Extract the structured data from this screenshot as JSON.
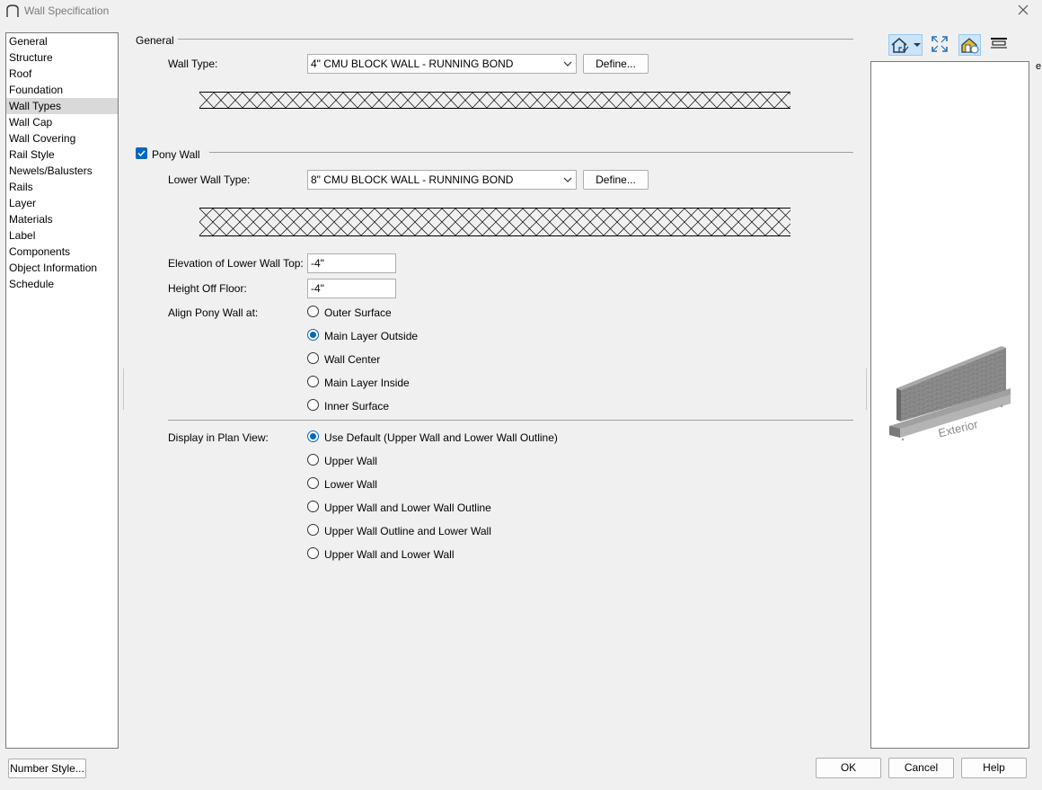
{
  "window": {
    "title": "Wall Specification"
  },
  "sidebar": {
    "items": [
      {
        "label": "General"
      },
      {
        "label": "Structure"
      },
      {
        "label": "Roof"
      },
      {
        "label": "Foundation"
      },
      {
        "label": "Wall Types",
        "selected": true
      },
      {
        "label": "Wall Cap"
      },
      {
        "label": "Wall Covering"
      },
      {
        "label": "Rail Style"
      },
      {
        "label": "Newels/Balusters"
      },
      {
        "label": "Rails"
      },
      {
        "label": "Layer"
      },
      {
        "label": "Materials"
      },
      {
        "label": "Label"
      },
      {
        "label": "Components"
      },
      {
        "label": "Object Information"
      },
      {
        "label": "Schedule"
      }
    ]
  },
  "general": {
    "section_label": "General",
    "wall_type_label": "Wall Type:",
    "wall_type_value": "4\" CMU BLOCK WALL - RUNNING BOND",
    "define_label": "Define..."
  },
  "pony": {
    "checkbox_label": "Pony Wall",
    "checked": true,
    "lower_wall_type_label": "Lower Wall Type:",
    "lower_wall_type_value": "8\" CMU BLOCK WALL - RUNNING BOND",
    "define_label": "Define...",
    "elevation_label": "Elevation of Lower Wall Top:",
    "elevation_value": "-4\"",
    "height_label": "Height Off Floor:",
    "height_value": "-4\"",
    "align_label": "Align Pony Wall at:",
    "align_options": [
      {
        "label": "Outer Surface",
        "checked": false
      },
      {
        "label": "Main Layer Outside",
        "checked": true
      },
      {
        "label": "Wall Center",
        "checked": false
      },
      {
        "label": "Main Layer Inside",
        "checked": false
      },
      {
        "label": "Inner Surface",
        "checked": false
      }
    ]
  },
  "display": {
    "label": "Display in Plan View:",
    "options": [
      {
        "label": "Use Default (Upper Wall and Lower Wall Outline)",
        "checked": true
      },
      {
        "label": "Upper Wall",
        "checked": false
      },
      {
        "label": "Lower Wall",
        "checked": false
      },
      {
        "label": "Upper Wall and Lower Wall Outline",
        "checked": false
      },
      {
        "label": "Upper Wall Outline and Lower Wall",
        "checked": false
      },
      {
        "label": "Upper Wall and Lower Wall",
        "checked": false
      }
    ]
  },
  "preview": {
    "exterior_label": "Exterior"
  },
  "footer": {
    "number_style_label": "Number Style...",
    "ok_label": "OK",
    "cancel_label": "Cancel",
    "help_label": "Help"
  },
  "colors": {
    "accent": "#0067c0",
    "selection": "#d9d9d9"
  }
}
